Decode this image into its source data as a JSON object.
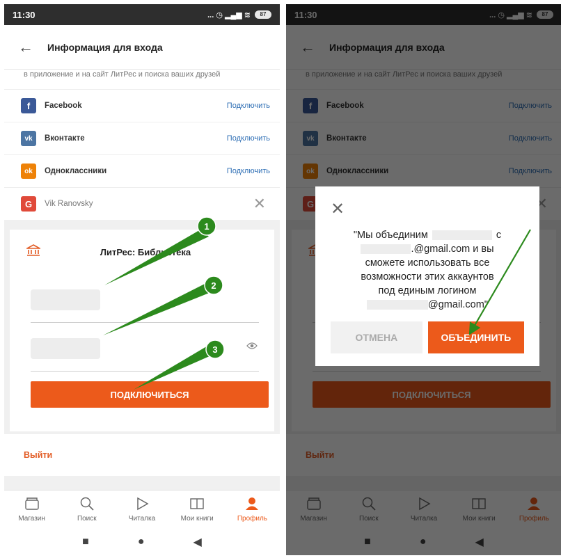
{
  "colors": {
    "accent": "#ec5a1b",
    "link": "#2f6fb5",
    "facebook": "#3b5998",
    "vk": "#4c75a3",
    "ok": "#ee8208",
    "google": "#e04a3a",
    "annotation_green": "#2c8a1d"
  },
  "status_bar": {
    "time": "11:30",
    "icons": "... ◷ ▂▄▆ ≋",
    "battery": "87"
  },
  "app_bar": {
    "back_icon": "←",
    "title": "Информация для входа"
  },
  "hint_text": "в приложение и на сайт ЛитРес и поиска ваших друзей",
  "social_accounts": [
    {
      "icon": "facebook-icon",
      "glyph": "f",
      "name": "Facebook",
      "action": "Подключить"
    },
    {
      "icon": "vk-icon",
      "glyph": "vk",
      "name": "Вконтакте",
      "action": "Подключить"
    },
    {
      "icon": "odnoklassniki-icon",
      "glyph": "ok",
      "name": "Одноклассники",
      "action": "Подключить"
    },
    {
      "icon": "google-icon",
      "glyph": "G",
      "name": "Vik Ranovsky",
      "action": "✕"
    }
  ],
  "library_card": {
    "icon": "library-icon",
    "title": "ЛитРес: Библиотека",
    "password_icon": "eye-icon",
    "button_label": "подключиться"
  },
  "logout_label": "Выйти",
  "bottom_nav": [
    {
      "icon": "store-icon",
      "label": "Магазин"
    },
    {
      "icon": "search-icon",
      "label": "Поиск"
    },
    {
      "icon": "play-icon",
      "label": "Читалка"
    },
    {
      "icon": "book-icon",
      "label": "Мои книги"
    },
    {
      "icon": "profile-icon",
      "label": "Профиль",
      "active": true
    }
  ],
  "system_nav": {
    "recents": "■",
    "home": "●",
    "back": "◀"
  },
  "annotations": {
    "marker_1": "1",
    "marker_2": "2",
    "marker_3": "3"
  },
  "dialog": {
    "close_icon": "✕",
    "message_line_1": "\"Мы объединим",
    "message_line_1b": "с",
    "message_line_2": ".@gmail.com и вы",
    "message_line_3": "сможете использовать все",
    "message_line_4": "возможности этих аккаунтов",
    "message_line_5": "под единым логином",
    "message_line_6": "@gmail.com\"",
    "cancel_label": "ОТМЕНА",
    "merge_label": "ОБЪЕДИНИТЬ"
  }
}
